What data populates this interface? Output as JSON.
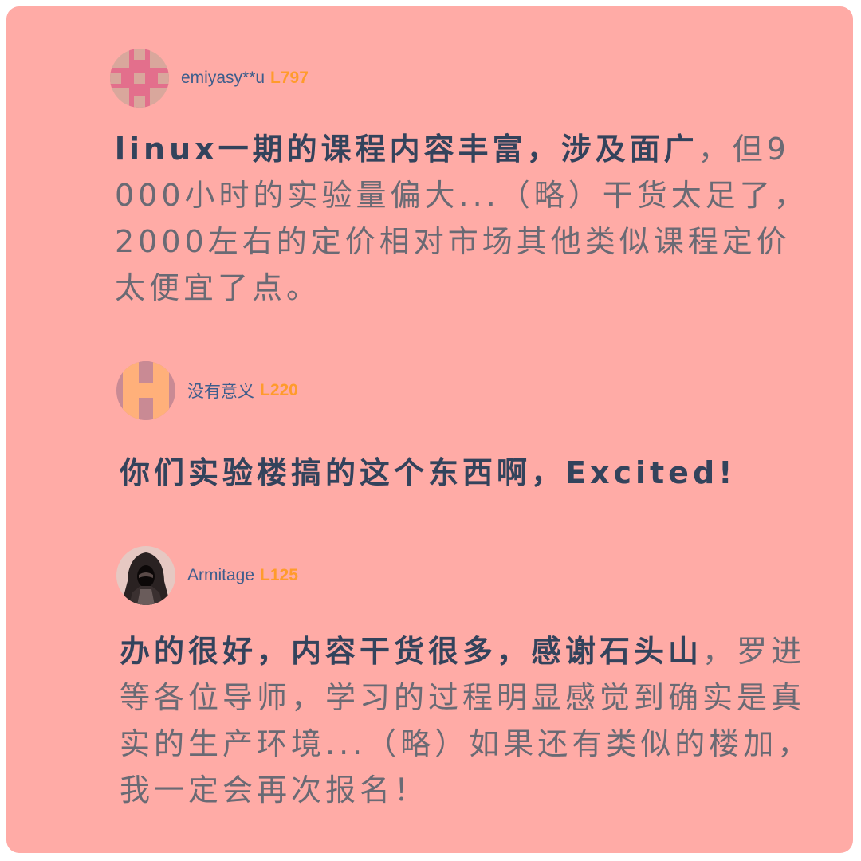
{
  "comments": [
    {
      "username": "emiyasy**u",
      "level": "L797",
      "avatar_icon": "pixel-cross-avatar-icon",
      "text_bold": "linux一期的课程内容丰富，涉及面广",
      "text_normal": "，但9000小时的实验量偏大...（略）干货太足了，2000左右的定价相对市场其他类似课程定价太便宜了点。"
    },
    {
      "username": "没有意义",
      "level": "L220",
      "avatar_icon": "pixel-h-avatar-icon",
      "text_bold": "你们实验楼搞的这个东西啊，Excited!",
      "text_normal": ""
    },
    {
      "username": "Armitage",
      "level": "L125",
      "avatar_icon": "hooded-figure-avatar-icon",
      "text_bold": "办的很好，内容干货很多，感谢石头山",
      "text_normal": "，罗进等各位导师，学习的过程明显感觉到确实是真实的生产环境...（略）如果还有类似的楼加，我一定会再次报名！"
    }
  ],
  "colors": {
    "background": "#ffaba6",
    "username": "#3d5d8c",
    "level": "#ff9b2c",
    "text_bold": "#33435c",
    "text_normal": "#6a6a74"
  }
}
